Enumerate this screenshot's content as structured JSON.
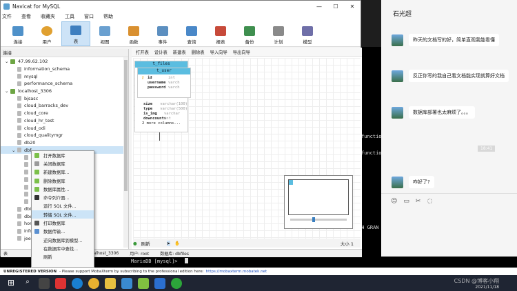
{
  "navicat": {
    "title": "Navicat for MySQL",
    "menu": [
      "文件",
      "查看",
      "收藏夹",
      "工具",
      "窗口",
      "帮助"
    ],
    "toolbar": [
      {
        "label": "连接",
        "icon": "plug-icon"
      },
      {
        "label": "用户",
        "icon": "user-icon"
      },
      {
        "label": "表",
        "icon": "table-icon",
        "active": true
      },
      {
        "label": "视图",
        "icon": "view-icon"
      },
      {
        "label": "函数",
        "icon": "function-icon"
      },
      {
        "label": "事件",
        "icon": "event-icon"
      },
      {
        "label": "查询",
        "icon": "query-icon"
      },
      {
        "label": "报表",
        "icon": "report-icon"
      },
      {
        "label": "备份",
        "icon": "backup-icon"
      },
      {
        "label": "计划",
        "icon": "schedule-icon"
      },
      {
        "label": "模型",
        "icon": "model-icon"
      }
    ],
    "conn_header": "连接",
    "tree": [
      {
        "label": "47.99.62.102",
        "level": 0,
        "type": "server"
      },
      {
        "label": "information_schema",
        "level": 1,
        "type": "db"
      },
      {
        "label": "mysql",
        "level": 1,
        "type": "db"
      },
      {
        "label": "performance_schema",
        "level": 1,
        "type": "db"
      },
      {
        "label": "localhost_3306",
        "level": 0,
        "type": "server"
      },
      {
        "label": "bjsasc",
        "level": 1,
        "type": "db"
      },
      {
        "label": "cloud_barracks_dev",
        "level": 1,
        "type": "db"
      },
      {
        "label": "cloud_core",
        "level": 1,
        "type": "db"
      },
      {
        "label": "cloud_hr_test",
        "level": 1,
        "type": "db"
      },
      {
        "label": "cloud_odi",
        "level": 1,
        "type": "db"
      },
      {
        "label": "cloud_qualitymgr",
        "level": 1,
        "type": "db"
      },
      {
        "label": "db20",
        "level": 1,
        "type": "db"
      },
      {
        "label": "dbf",
        "level": 1,
        "type": "db",
        "selected": true
      },
      {
        "label": "",
        "level": 2,
        "type": "table"
      },
      {
        "label": "",
        "level": 2,
        "type": "view"
      },
      {
        "label": "",
        "level": 2,
        "type": "func"
      },
      {
        "label": "",
        "level": 2,
        "type": "event"
      },
      {
        "label": "",
        "level": 2,
        "type": "query"
      },
      {
        "label": "",
        "level": 2,
        "type": "report"
      },
      {
        "label": "",
        "level": 2,
        "type": "backup"
      },
      {
        "label": "dbi",
        "level": 1,
        "type": "db"
      },
      {
        "label": "dbc",
        "level": 1,
        "type": "db"
      },
      {
        "label": "hon",
        "level": 1,
        "type": "db"
      },
      {
        "label": "info",
        "level": 1,
        "type": "db"
      },
      {
        "label": "jees",
        "level": 1,
        "type": "db"
      }
    ],
    "context_menu": [
      {
        "label": "打开数据库",
        "icon": "open-db-icon"
      },
      {
        "label": "关闭数据库",
        "icon": "close-db-icon"
      },
      {
        "label": "新建数据库...",
        "icon": "new-db-icon"
      },
      {
        "label": "删除数据库",
        "icon": "delete-db-icon"
      },
      {
        "label": "数据库属性...",
        "icon": "db-properties-icon"
      },
      {
        "label": "命令列介面...",
        "icon": "console-icon"
      },
      {
        "label": "运行 SQL 文件...",
        "icon": ""
      },
      {
        "label": "转储 SQL 文件...",
        "icon": "",
        "highlight": true
      },
      {
        "label": "打印数据库",
        "icon": "print-icon"
      },
      {
        "label": "数据传输...",
        "icon": "transfer-icon"
      },
      {
        "label": "逆向数据库到模型...",
        "icon": ""
      },
      {
        "label": "在数据库中查找...",
        "icon": ""
      },
      {
        "label": "刷新",
        "icon": ""
      }
    ],
    "objbar": [
      "打开表",
      "设计表",
      "新建表",
      "删除表",
      "导入向导",
      "导出向导"
    ],
    "entities": {
      "files": {
        "title": "t_files",
        "fields": [
          {
            "name": "size",
            "type": "varchar(100)"
          },
          {
            "name": "type",
            "type": "varchar(500)"
          },
          {
            "name": "is_img",
            "type": "varchar"
          },
          {
            "name": "downcounts",
            "type": "int"
          }
        ],
        "more": "2 more columns..."
      },
      "user": {
        "title": "t_user",
        "fields": [
          {
            "name": "id",
            "type": "int",
            "key": true
          },
          {
            "name": "username",
            "type": "varch"
          },
          {
            "name": "password",
            "type": "varch"
          }
        ]
      }
    },
    "canvas_footer": {
      "refresh": "刷新",
      "size": "大小 1"
    },
    "status": [
      "表",
      "localhost_3306",
      "用户: root",
      "数据库: dbfiles"
    ]
  },
  "terminal": {
    "lines": [
      {
        "text": "function"
      },
      {
        "text": "function"
      },
      {
        "text": "TH GRAN"
      }
    ],
    "prompt": "MariaDB [mysql]> "
  },
  "chat": {
    "contact": "石光超",
    "messages": [
      {
        "text": "昨天的文档写的好，简单直观我能看懂"
      },
      {
        "text": "反正你写的我自己看文档能实现就算好文档"
      },
      {
        "text": "数据库部署也太麻烦了。。。"
      },
      {
        "text": "咋好了?"
      }
    ],
    "timestamp": "18:41",
    "toolbar_icons": [
      "emoji-icon",
      "folder-icon",
      "scissors-icon",
      "chat-icon"
    ]
  },
  "mobaxterm": {
    "notice_bold": "UNREGISTERED VERSION",
    "notice": "- Please support MobaXterm by subscribing to the professional edition here:",
    "link": "https://mobaxterm.mobatek.net"
  },
  "taskbar": {
    "date": "2021/11/18",
    "watermark": "CSDN @博客小翔"
  },
  "colors": {
    "accent": "#5bbde0",
    "selection": "#cce4f7",
    "taskbar": "#1f2533"
  }
}
